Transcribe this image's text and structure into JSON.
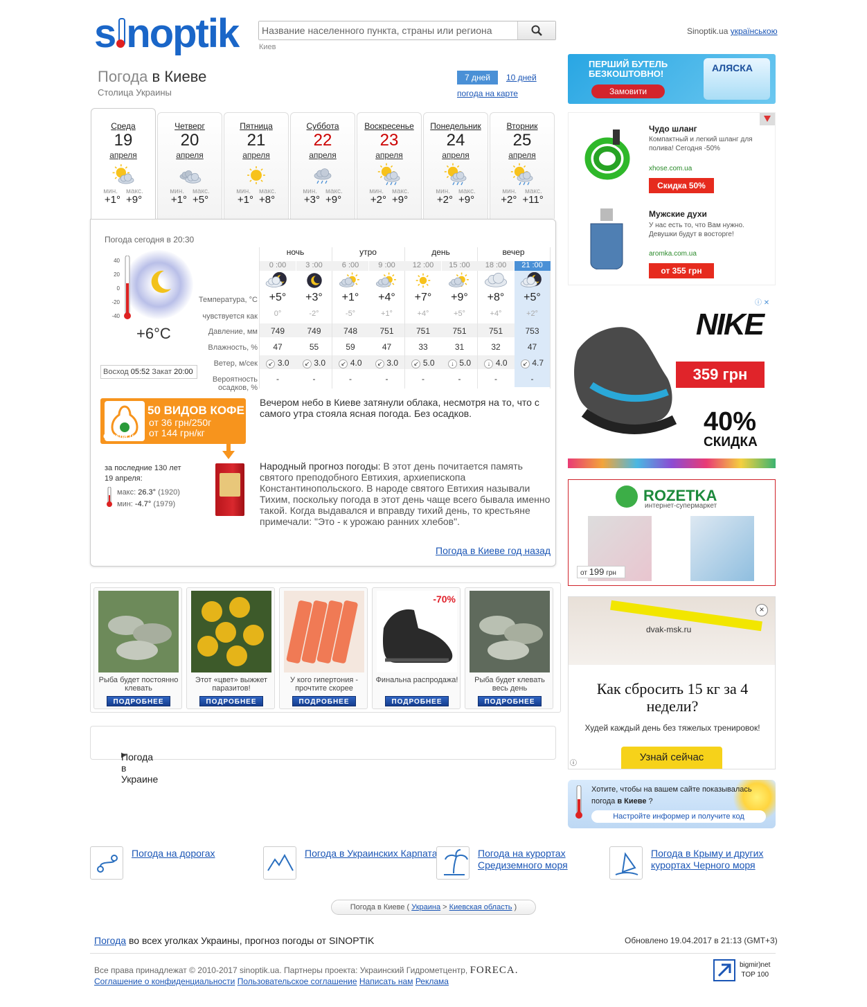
{
  "header": {
    "logo_text_left": "s",
    "logo_text_right": "noptik",
    "search": {
      "placeholder": "Название населенного пункта, страны или региона",
      "hint": "Киев"
    },
    "lang_prefix": "Sinoptik.ua",
    "lang_link": "українською"
  },
  "title": {
    "prefix": "Погода",
    "city": "в Киеве",
    "subtitle": "Столица Украины",
    "tab_7": "7 дней",
    "tab_10": "10 дней",
    "map_link": "погода на карте"
  },
  "days": [
    {
      "name": "Среда",
      "num": "19",
      "month": "апреля",
      "min_label": "мин.",
      "max_label": "макс.",
      "min": "+1°",
      "max": "+9°",
      "icon": "partly-cloudy-icon",
      "weekend": false
    },
    {
      "name": "Четверг",
      "num": "20",
      "month": "апреля",
      "min_label": "мин.",
      "max_label": "макс.",
      "min": "+1°",
      "max": "+5°",
      "icon": "cloudy-icon",
      "weekend": false
    },
    {
      "name": "Пятница",
      "num": "21",
      "month": "апреля",
      "min_label": "мин.",
      "max_label": "макс.",
      "min": "+1°",
      "max": "+8°",
      "icon": "sun-icon",
      "weekend": false
    },
    {
      "name": "Суббота",
      "num": "22",
      "month": "апреля",
      "min_label": "мин.",
      "max_label": "макс.",
      "min": "+3°",
      "max": "+9°",
      "icon": "rain-cloud-icon",
      "weekend": true
    },
    {
      "name": "Воскресенье",
      "num": "23",
      "month": "апреля",
      "min_label": "мин.",
      "max_label": "макс.",
      "min": "+2°",
      "max": "+9°",
      "icon": "sun-rain-icon",
      "weekend": true
    },
    {
      "name": "Понедельник",
      "num": "24",
      "month": "апреля",
      "min_label": "мин.",
      "max_label": "макс.",
      "min": "+2°",
      "max": "+9°",
      "icon": "sun-rain-icon",
      "weekend": false
    },
    {
      "name": "Вторник",
      "num": "25",
      "month": "апреля",
      "min_label": "мин.",
      "max_label": "макс.",
      "min": "+2°",
      "max": "+11°",
      "icon": "sun-rain-icon",
      "weekend": false
    }
  ],
  "now": {
    "label": "Погода сегодня в 20:30",
    "temp": "+6°C",
    "scale": [
      "40",
      "20",
      "0",
      "-20",
      "-40"
    ],
    "sunrise_label": "Восход",
    "sunrise": "05:52",
    "sunset_label": "Закат",
    "sunset": "20:00"
  },
  "hourly": {
    "periods": [
      "ночь",
      "утро",
      "день",
      "вечер"
    ],
    "labels": {
      "temp": "Температура, °C",
      "feels": "чувствуется как",
      "pressure": "Давление, мм",
      "humidity": "Влажность, %",
      "wind": "Ветер, м/сек",
      "precip1": "Вероятность",
      "precip2": "осадков, %"
    },
    "times": [
      "0 :00",
      "3 :00",
      "6 :00",
      "9 :00",
      "12 :00",
      "15 :00",
      "18 :00",
      "21 :00"
    ],
    "icons": [
      "cloud-moon-icon",
      "moon-icon",
      "sun-cloud-icon",
      "sun-cloud-icon",
      "sun-icon",
      "sun-cloud-icon",
      "cloud-icon",
      "cloud-moon-icon"
    ],
    "temp": [
      "+5°",
      "+3°",
      "+1°",
      "+4°",
      "+7°",
      "+9°",
      "+8°",
      "+5°"
    ],
    "feels": [
      "0°",
      "-2°",
      "-5°",
      "+1°",
      "+4°",
      "+5°",
      "+4°",
      "+2°"
    ],
    "pressure": [
      "749",
      "749",
      "748",
      "751",
      "751",
      "751",
      "751",
      "753"
    ],
    "humidity": [
      "47",
      "55",
      "59",
      "47",
      "33",
      "31",
      "32",
      "47"
    ],
    "wind": [
      "3.0",
      "3.0",
      "4.0",
      "3.0",
      "5.0",
      "5.0",
      "4.0",
      "4.7"
    ],
    "wind_dir": [
      "↙",
      "↙",
      "↙",
      "↙",
      "↙",
      "↓",
      "↓",
      "↙"
    ],
    "precip": [
      "-",
      "-",
      "-",
      "-",
      "-",
      "-",
      "-",
      "-"
    ]
  },
  "description": {
    "text1": "Вечером небо в Киеве затянули облака, несмотря на то, что с самого утра стояла ясная погода. Без осадков.",
    "text2_label": "Народный прогноз погоды:",
    "text2": " В этот день почитается память святого преподобного Евтихия, архиепископа Константинопольского. В народе святого Евтихия называли Тихим, поскольку погода в этот день чаще всего бывала именно такой. Когда выдавался и вправду тихий день, то крестьяне примечали: \"Это - к урожаю ранних хлебов\".",
    "history1": "за последние 130 лет",
    "history2": "19 апреля:",
    "max_label": "макс:",
    "max_val": "26.3°",
    "max_year": "(1920)",
    "min_label": "мин:",
    "min_val": "-4.7°",
    "min_year": "(1979)",
    "year_ago": "Погода в Киеве год назад"
  },
  "coffee_ad": {
    "title": "50 ВИДОВ КОФЕ",
    "line1": "от 36 грн/250г",
    "line2": "от 144 грн/кг",
    "brand": "Grusha.ua"
  },
  "news": [
    {
      "caption": "Рыба будет постоянно клевать",
      "more": "ПОДРОБНЕЕ",
      "color": "#6d8a5a"
    },
    {
      "caption": "Этот «цвет» выжжет паразитов!",
      "more": "ПОДРОБНЕЕ",
      "color": "#e5b419"
    },
    {
      "caption": "У кого гипертония - прочтите скорее",
      "more": "ПОДРОБНЕЕ",
      "color": "#f07a55"
    },
    {
      "caption": "Финальна распродажа!",
      "more": "ПОДРОБНЕЕ",
      "color": "#ffffff",
      "badge": "-70%"
    },
    {
      "caption": "Рыба будет клевать весь день",
      "more": "ПОДРОБНЕЕ",
      "color": "#5f6a5c"
    }
  ],
  "ukraine_label": "Погода в Украине",
  "ads": {
    "ad1": {
      "line1": "ПЕРШИЙ БУТЕЛЬ",
      "line2": "БЕЗКОШТОВНО!",
      "button": "Замовити",
      "brand": "АЛЯСКА"
    },
    "ad2": [
      {
        "title": "Чудо шланг",
        "text": "Компактный и легкий шланг для полива! Сегодня -50%",
        "url": "xhose.com.ua",
        "button": "Скидка 50%"
      },
      {
        "title": "Мужские духи",
        "text": "У нас есть то, что Вам нужно. Девушки будут в восторге!",
        "url": "aromka.com.ua",
        "button": "от 355 грн"
      }
    ],
    "ad3": {
      "brand": "NIKE",
      "price": "359 грн",
      "pct": "40%",
      "label": "СКИДКА"
    },
    "ad4": {
      "brand": "ROZETKA",
      "sub": "интернет-супермаркет",
      "price_prefix": "от",
      "price": "199",
      "price_suffix": "грн"
    },
    "ad5": {
      "site": "dvak-msk.ru",
      "headline": "Как сбросить 15 кг за 4 недели?",
      "sub": "Худей каждый день без тяжелых тренировок!",
      "button": "Узнай сейчас",
      "close": "×"
    }
  },
  "informer": {
    "text1": "Хотите, чтобы на вашем сайте показывалась погода ",
    "city": "в Киеве",
    "text2": " ?",
    "button": "Настройте информер и получите код"
  },
  "bottom_links": [
    {
      "text": "Погода на дорогах",
      "icon": "road-icon"
    },
    {
      "text": "Погода в Украинских Карпатах",
      "icon": "mountains-icon"
    },
    {
      "text": "Погода на курортах Средиземного моря",
      "icon": "palm-icon"
    },
    {
      "text": "Погода в Крыму и других курортах Черного моря",
      "icon": "windsurf-icon"
    }
  ],
  "breadcrumbs": {
    "current": "Погода в Киеве (",
    "country": "Украина",
    "sep": ">",
    "region": "Киевская область",
    "end": ")"
  },
  "footer": {
    "link": "Погода",
    "text": " во всех уголках Украины, прогноз погоды от SINOPTIK",
    "updated": "Обновлено 19.04.2017 в 21:13 (GMT+3)",
    "copyright": "Все права принадлежат © 2010-2017 sinoptik.ua. Партнеры проекта: Украинский Гидрометцентр,",
    "foreca": "FORECA.",
    "links": [
      "Соглашение о конфиденциальности",
      "Пользовательское соглашение",
      "Написать нам",
      "Реклама"
    ],
    "counter1": "bigmir)net",
    "counter2": "TOP 100"
  },
  "colors": {
    "brand": "#1a66c8",
    "link": "#1a55b5",
    "weekend": "#cc0000",
    "accent": "#4a90d6"
  }
}
